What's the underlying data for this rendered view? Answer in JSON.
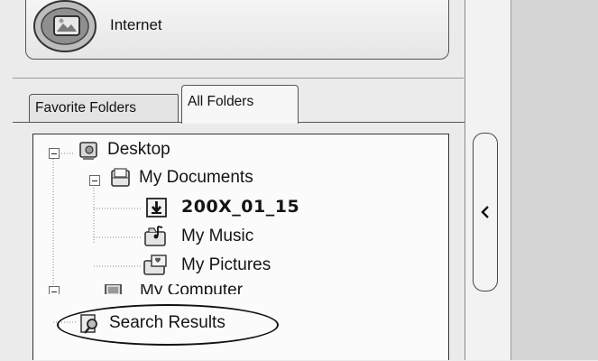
{
  "internet": {
    "label": "Internet",
    "icon": "internet-globe-icon"
  },
  "tabs": [
    {
      "label": "Favorite Folders",
      "active": false
    },
    {
      "label": "All Folders",
      "active": true
    }
  ],
  "tree": {
    "desktop": "Desktop",
    "my_documents": "My Documents",
    "folder_200x": "200X_01_15",
    "my_music": "My Music",
    "my_pictures": "My Pictures",
    "my_computer": "My Computer",
    "search_results": "Search Results"
  },
  "collapse_arrow": "<",
  "colors": {
    "background": "#ebebeb",
    "right_area": "#d5d5d5",
    "tree_bg": "#fbfbfb"
  }
}
